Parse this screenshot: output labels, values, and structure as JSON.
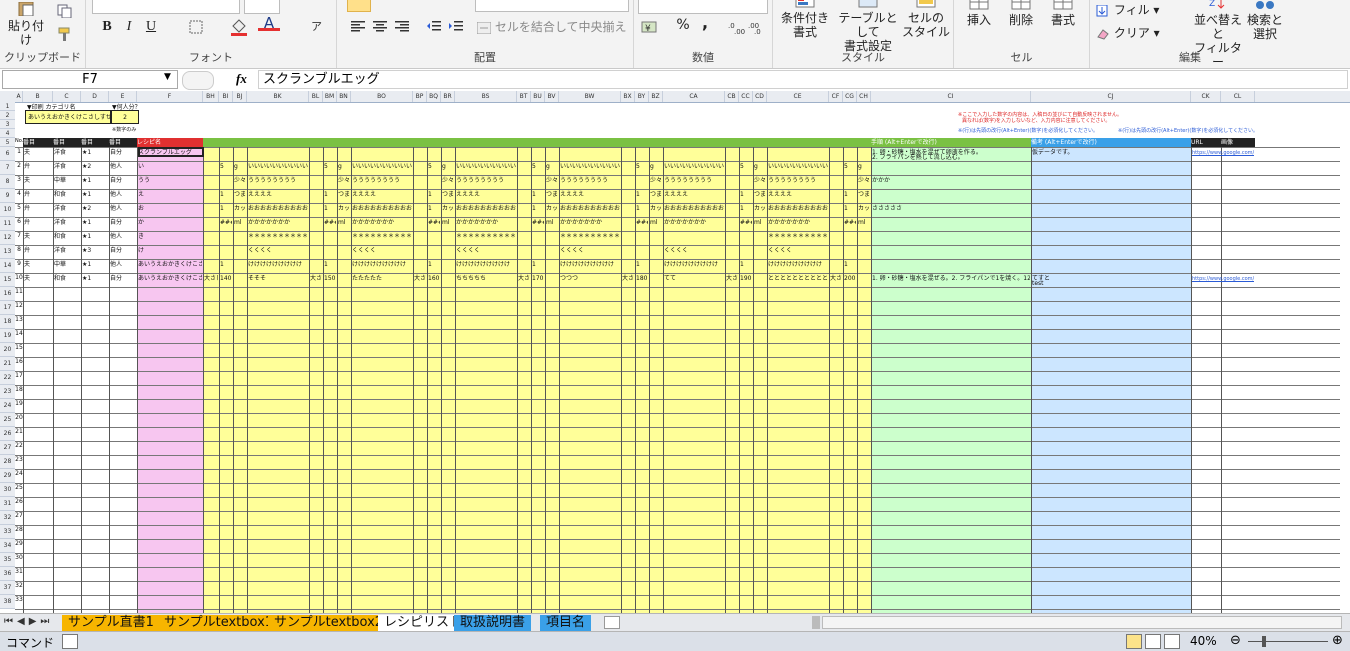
{
  "ribbon": {
    "paste_label": "貼り付け",
    "clipboard_group": "クリップボード",
    "font_group": "フォント",
    "align_group": "配置",
    "number_group": "数値",
    "style_group": "スタイル",
    "cells_group": "セル",
    "edit_group": "編集",
    "merge_label": "セルを結合して中央揃え",
    "percent": "%",
    "comma": ",",
    "bold": "B",
    "italic": "I",
    "underline": "U",
    "cond_format_l1": "条件付き",
    "cond_format_l2": "書式",
    "table_format_l1": "テーブルとして",
    "table_format_l2": "書式設定",
    "cell_style_l1": "セルの",
    "cell_style_l2": "スタイル",
    "insert": "挿入",
    "delete": "削除",
    "format": "書式",
    "fill": "フィル",
    "clear": "クリア",
    "sort_l1": "並べ替えと",
    "sort_l2": "フィルター",
    "find_l1": "検索と",
    "find_l2": "選択"
  },
  "formula_bar": {
    "name_box": "F7",
    "fx": "fx",
    "value": "スクランブルエッグ"
  },
  "columns": [
    "A",
    "B",
    "C",
    "D",
    "E",
    "F",
    "BH",
    "BI",
    "BJ",
    "BK",
    "BL",
    "BM",
    "BN",
    "BO",
    "BP",
    "BQ",
    "BR",
    "BS",
    "BT",
    "BU",
    "BV",
    "BW",
    "BX",
    "BY",
    "BZ",
    "CA",
    "CB",
    "CC",
    "CD",
    "CE",
    "CF",
    "CG",
    "CH",
    "CI",
    "CJ",
    "CK",
    "CL"
  ],
  "top": {
    "b1": "▼印刷 カテゴリ名",
    "e1": "▼何人分？",
    "b2": "あいうえおかきくけこさしすせそ",
    "e2": "2",
    "e3": "※数字のみ",
    "ci1": "※ここで入力した数字の内容は、入稿日の並びにて自動反映されません。",
    "ci2": "異なれば(数字)を入力しないなど、入力内容に注意してください。",
    "ci4": "※(行)は先頭の改行(Alt+Enter)(数字)を必須化してください。",
    "cj4": "※(行)は先頭の改行(Alt+Enter)(数字)を必須化してください。"
  },
  "header": {
    "no": "No.",
    "b": "番目",
    "c": "番目",
    "d": "番目",
    "e": "番目",
    "f": "レシピ名",
    "ci": "手順 (Alt+Enterで改行)",
    "cj": "備考 (Alt+Enterで改行)",
    "ck": "URL",
    "cl": "画像"
  },
  "rows": [
    {
      "n": "1",
      "b": "夫",
      "c": "洋食",
      "d": "★1",
      "e": "自分",
      "f": "スクランブルエッグ",
      "bi": "",
      "bk": "",
      "ci": "1. 卵・砂糖・塩水を混ぜて卵液を作る。",
      "ci2": "2. フライパンを熱して流し込む。",
      "cj": "仮データです。",
      "ck": "https://www.google.com/?",
      "g1": "",
      "g2": "",
      "g3": "",
      "g4": "",
      "g5": "",
      "g6": "",
      "g7": "",
      "g8": "",
      "g9": "",
      "g10": "",
      "g11": "",
      "g12": "",
      "g13": "",
      "g14": "",
      "g15": ""
    },
    {
      "n": "2",
      "b": "弁",
      "c": "洋食",
      "d": "★2",
      "e": "他人",
      "f": "い",
      "bi": "5",
      "bj": "g",
      "bk": "いいいいいいいいいい",
      "bm": "5",
      "bn": "g",
      "bo": "いいいいいいいいいい",
      "bq": "5",
      "br": "g",
      "bs": "いいいいいいいいいい",
      "bu": "5",
      "bv": "g",
      "bw": "いいいいいいいいいい",
      "by": "5",
      "bz": "g",
      "ca": "いいいいいいいいいい",
      "cc": "5",
      "cd": "g",
      "ce": "いいいいいいいいいい",
      "cg": "5",
      "ch": "g"
    },
    {
      "n": "3",
      "b": "夫",
      "c": "中華",
      "d": "★1",
      "e": "自分",
      "f": "うう",
      "bj": "少々",
      "bk": "うううううううう",
      "bn": "少々",
      "bo": "うううううううう",
      "br": "少々",
      "bs": "うううううううう",
      "bv": "少々",
      "bw": "うううううううう",
      "bz": "少々",
      "ca": "うううううううう",
      "cd": "少々",
      "ce": "うううううううう",
      "ch": "少々",
      "ci": "かかか"
    },
    {
      "n": "4",
      "b": "弁",
      "c": "和食",
      "d": "★1",
      "e": "他人",
      "f": "え",
      "bi": "1",
      "bj": "つまみ",
      "bk": "ええええ",
      "bm": "1",
      "bn": "つまみ",
      "bo": "ええええ",
      "bq": "1",
      "br": "つまみ",
      "bs": "ええええ",
      "bu": "1",
      "bv": "つまみ",
      "bw": "ええええ",
      "by": "1",
      "bz": "つまみ",
      "ca": "ええええ",
      "cc": "1",
      "cd": "つまみ",
      "ce": "ええええ",
      "cg": "1",
      "ch": "つまみ"
    },
    {
      "n": "5",
      "b": "弁",
      "c": "洋食",
      "d": "★2",
      "e": "他人",
      "f": "お",
      "bi": "1",
      "bj": "カップ",
      "bk": "おおおおおおおおおお",
      "bm": "1",
      "bn": "カップ",
      "bo": "おおおおおおおおおお",
      "bq": "1",
      "br": "カップ",
      "bs": "おおおおおおおおおお",
      "bu": "1",
      "bv": "カップ",
      "bw": "おおおおおおおおおお",
      "by": "1",
      "bz": "カップ",
      "ca": "おおおおおおおおおお",
      "cc": "1",
      "cd": "カップ",
      "ce": "おおおおおおおおおお",
      "cg": "1",
      "ch": "カップ",
      "ci": "さささささ"
    },
    {
      "n": "6",
      "b": "弁",
      "c": "洋食",
      "d": "★1",
      "e": "自分",
      "f": "か",
      "bi": "####",
      "bj": "ml",
      "bk": "かかかかかかか",
      "bm": "####",
      "bn": "ml",
      "bo": "かかかかかかか",
      "bq": "####",
      "br": "ml",
      "bs": "かかかかかかか",
      "bu": "####",
      "bv": "ml",
      "bw": "かかかかかかか",
      "by": "####",
      "bz": "ml",
      "ca": "かかかかかかか",
      "cc": "####",
      "cd": "ml",
      "ce": "かかかかかかか",
      "cg": "####",
      "ch": "ml"
    },
    {
      "n": "7",
      "b": "夫",
      "c": "和食",
      "d": "★1",
      "e": "他人",
      "f": "き",
      "bk": "＊＊＊＊＊＊＊＊＊＊＊",
      "bo": "＊＊＊＊＊＊＊＊＊＊＊",
      "bs": "＊＊＊＊＊＊＊＊＊＊＊",
      "bw": "＊＊＊＊＊＊＊＊＊＊＊",
      "ca": "",
      "ce": "＊＊＊＊＊＊＊＊＊＊＊"
    },
    {
      "n": "8",
      "b": "弁",
      "c": "洋食",
      "d": "★3",
      "e": "自分",
      "f": "け",
      "bk": "くくくく",
      "bo": "くくくく",
      "bs": "くくくく",
      "bw": "くくくく",
      "ca": "くくくく",
      "ce": "くくくく"
    },
    {
      "n": "9",
      "b": "夫",
      "c": "中華",
      "d": "★1",
      "e": "他人",
      "f": "あいうえおかきくけこさしすせそたちつてとなに",
      "bi": "1",
      "bk": "けけけけけけけけけ",
      "bm": "1",
      "bo": "けけけけけけけけけ",
      "bq": "1",
      "bs": "けけけけけけけけけ",
      "bu": "1",
      "bw": "けけけけけけけけけ",
      "by": "1",
      "ca": "けけけけけけけけけ",
      "cc": "1",
      "ce": "けけけけけけけけけ",
      "cg": "1"
    },
    {
      "n": "10",
      "b": "夫",
      "c": "和食",
      "d": "★1",
      "e": "自分",
      "f": "あいうえおかきくけこさしすせそ",
      "bh": "大さじ",
      "bi": "140",
      "bk": "そそそ",
      "bl": "大さじ",
      "bm": "150",
      "bo": "たたたたた",
      "bp": "大さじ",
      "bq": "160",
      "bs": "ちちちちち",
      "bt": "大さじ",
      "bu": "170",
      "bw": "つつつ",
      "bx": "大さじ",
      "by": "180",
      "ca": "てて",
      "cb": "大さじ",
      "cc": "190",
      "ce": "とととととととととと",
      "cf": "大さじ",
      "cg": "200",
      "ci": "1. 卵・砂糖・塩水を混ぜる。2. フライパンで1を焼く。1234567",
      "cj": "てすと",
      "cj2": "test",
      "ck": "https://www.google.com/?h"
    }
  ],
  "row_numbers": [
    "1",
    "2",
    "3",
    "4",
    "5",
    "6",
    "7",
    "8",
    "9",
    "10",
    "11",
    "12",
    "13",
    "14",
    "15",
    "16",
    "17",
    "18",
    "19",
    "20",
    "21",
    "22",
    "23",
    "24",
    "25",
    "26",
    "27",
    "28",
    "29",
    "30",
    "31",
    "32",
    "33"
  ],
  "excel_rows": [
    "1",
    "2",
    "3",
    "4",
    "5",
    "6",
    "7",
    "8",
    "9",
    "10",
    "11",
    "12",
    "13",
    "14",
    "15",
    "16",
    "17",
    "18",
    "19",
    "20",
    "21",
    "22",
    "23",
    "24",
    "25",
    "26",
    "27",
    "28",
    "29",
    "30",
    "31",
    "32",
    "33",
    "34",
    "35",
    "36",
    "37",
    "38"
  ],
  "tabs": [
    "サンプル直書1",
    "サンプルtextbox1",
    "サンプルtextbox2",
    "レシピリスト",
    "取扱説明書",
    "項目名"
  ],
  "active_tab": "レシピリスト",
  "status": {
    "mode": "コマンド",
    "zoom": "40%"
  },
  "colors": {
    "pink": "#f7c6f0",
    "yellow": "#ffff99",
    "green": "#ccffcc",
    "blue": "#cce6ff",
    "hdr_green": "#7ac143",
    "hdr_blue": "#3aa0e8",
    "hdr_red": "#e03030"
  }
}
